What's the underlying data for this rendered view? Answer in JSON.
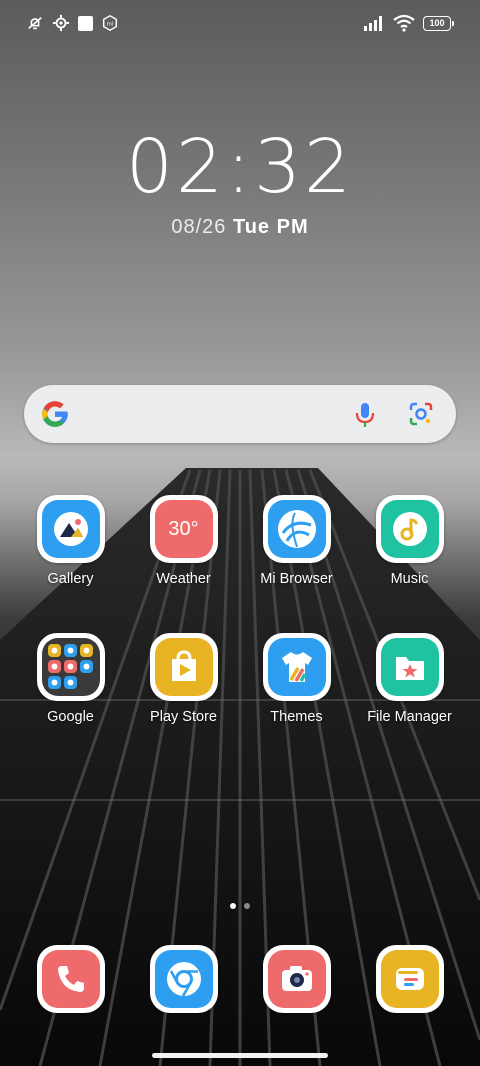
{
  "status_bar": {
    "battery": "100",
    "left_icons": [
      "mute-off-icon",
      "settings-gear-icon",
      "white-square-icon",
      "mi-badge-icon"
    ],
    "right_icons": [
      "signal-icon",
      "wifi-icon",
      "battery-icon"
    ]
  },
  "clock": {
    "time": "02:32",
    "date": "08/26",
    "weekday": "Tue",
    "ampm": "PM"
  },
  "search": {
    "icons": [
      "google-g-icon",
      "microphone-icon",
      "google-lens-icon"
    ]
  },
  "apps": [
    {
      "label": "Gallery",
      "color": "#2e9ff0"
    },
    {
      "label": "Weather",
      "color": "#ef6b6b",
      "badge": "30°"
    },
    {
      "label": "Mi Browser",
      "color": "#2e9ff0"
    },
    {
      "label": "Music",
      "color": "#1fc3a1"
    },
    {
      "label": "Google",
      "color": "#3a3a3a"
    },
    {
      "label": "Play Store",
      "color": "#e8b423"
    },
    {
      "label": "Themes",
      "color": "#2e9ff0"
    },
    {
      "label": "File Manager",
      "color": "#1fc3a1"
    }
  ],
  "dock": [
    {
      "name": "phone",
      "color": "#ef6b6b"
    },
    {
      "name": "chrome",
      "color": "#2e9ff0"
    },
    {
      "name": "camera",
      "color": "#ef6b6b"
    },
    {
      "name": "messages",
      "color": "#e8b423"
    }
  ],
  "page_indicator": {
    "total": 2,
    "active": 1
  }
}
